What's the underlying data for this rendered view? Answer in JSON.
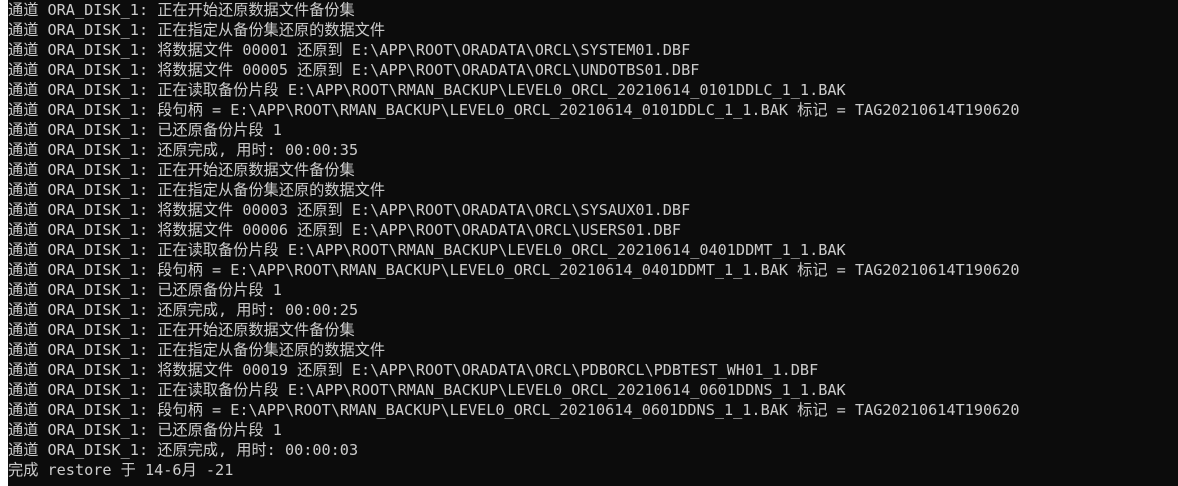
{
  "terminal": {
    "lines": [
      "通道 ORA_DISK_1: 正在开始还原数据文件备份集",
      "通道 ORA_DISK_1: 正在指定从备份集还原的数据文件",
      "通道 ORA_DISK_1: 将数据文件 00001 还原到 E:\\APP\\ROOT\\ORADATA\\ORCL\\SYSTEM01.DBF",
      "通道 ORA_DISK_1: 将数据文件 00005 还原到 E:\\APP\\ROOT\\ORADATA\\ORCL\\UNDOTBS01.DBF",
      "通道 ORA_DISK_1: 正在读取备份片段 E:\\APP\\ROOT\\RMAN_BACKUP\\LEVEL0_ORCL_20210614_0101DDLC_1_1.BAK",
      "通道 ORA_DISK_1: 段句柄 = E:\\APP\\ROOT\\RMAN_BACKUP\\LEVEL0_ORCL_20210614_0101DDLC_1_1.BAK 标记 = TAG20210614T190620",
      "通道 ORA_DISK_1: 已还原备份片段 1",
      "通道 ORA_DISK_1: 还原完成, 用时: 00:00:35",
      "通道 ORA_DISK_1: 正在开始还原数据文件备份集",
      "通道 ORA_DISK_1: 正在指定从备份集还原的数据文件",
      "通道 ORA_DISK_1: 将数据文件 00003 还原到 E:\\APP\\ROOT\\ORADATA\\ORCL\\SYSAUX01.DBF",
      "通道 ORA_DISK_1: 将数据文件 00006 还原到 E:\\APP\\ROOT\\ORADATA\\ORCL\\USERS01.DBF",
      "通道 ORA_DISK_1: 正在读取备份片段 E:\\APP\\ROOT\\RMAN_BACKUP\\LEVEL0_ORCL_20210614_0401DDMT_1_1.BAK",
      "通道 ORA_DISK_1: 段句柄 = E:\\APP\\ROOT\\RMAN_BACKUP\\LEVEL0_ORCL_20210614_0401DDMT_1_1.BAK 标记 = TAG20210614T190620",
      "通道 ORA_DISK_1: 已还原备份片段 1",
      "通道 ORA_DISK_1: 还原完成, 用时: 00:00:25",
      "通道 ORA_DISK_1: 正在开始还原数据文件备份集",
      "通道 ORA_DISK_1: 正在指定从备份集还原的数据文件",
      "通道 ORA_DISK_1: 将数据文件 00019 还原到 E:\\APP\\ROOT\\ORADATA\\ORCL\\PDBORCL\\PDBTEST_WH01_1.DBF",
      "通道 ORA_DISK_1: 正在读取备份片段 E:\\APP\\ROOT\\RMAN_BACKUP\\LEVEL0_ORCL_20210614_0601DDNS_1_1.BAK",
      "通道 ORA_DISK_1: 段句柄 = E:\\APP\\ROOT\\RMAN_BACKUP\\LEVEL0_ORCL_20210614_0601DDNS_1_1.BAK 标记 = TAG20210614T190620",
      "通道 ORA_DISK_1: 已还原备份片段 1",
      "通道 ORA_DISK_1: 还原完成, 用时: 00:00:03",
      "完成 restore 于 14-6月 -21"
    ]
  },
  "colors": {
    "background": "#0c0c0c",
    "text": "#cccccc"
  }
}
